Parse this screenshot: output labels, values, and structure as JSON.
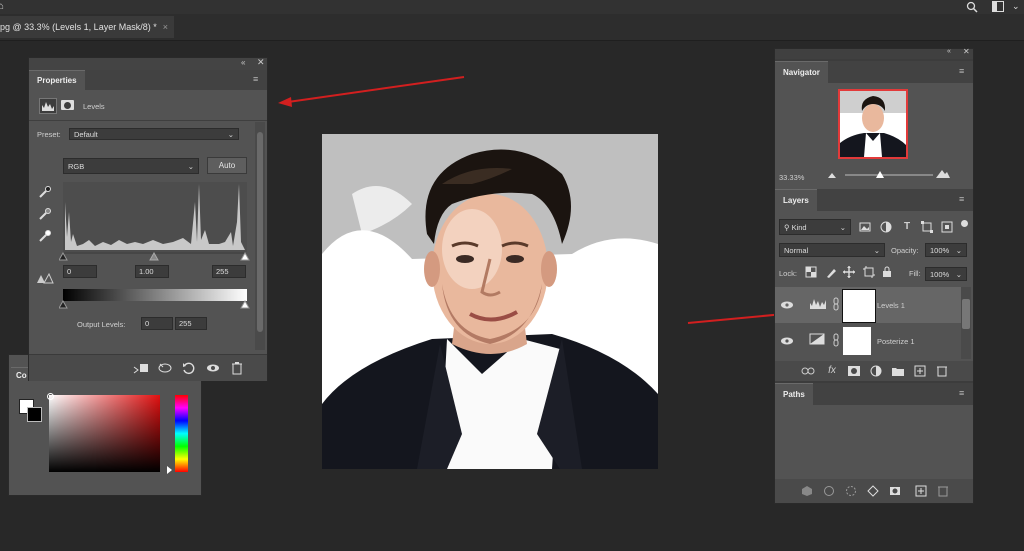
{
  "document": {
    "tab_title": "pg @ 33.3% (Levels 1, Layer Mask/8) *",
    "close_glyph": "×"
  },
  "properties": {
    "tab_label": "Properties",
    "header_label": "Levels",
    "preset_label": "Preset:",
    "preset_value": "Default",
    "channel_value": "RGB",
    "auto_label": "Auto",
    "input_black": "0",
    "input_gamma": "1.00",
    "input_white": "255",
    "output_label": "Output Levels:",
    "output_black": "0",
    "output_white": "255"
  },
  "color_panel": {
    "tab_label": "Co"
  },
  "navigator": {
    "tab_label": "Navigator",
    "zoom_value": "33.33%"
  },
  "layers": {
    "tab_label": "Layers",
    "kind_label": "Kind",
    "blend_mode": "Normal",
    "opacity_label": "Opacity:",
    "opacity_value": "100%",
    "lock_label": "Lock:",
    "fill_label": "Fill:",
    "fill_value": "100%",
    "items": [
      {
        "name": "Levels 1",
        "selected": true,
        "icon": "levels-adjustment-icon"
      },
      {
        "name": "Posterize 1",
        "selected": false,
        "icon": "posterize-adjustment-icon"
      }
    ]
  },
  "paths": {
    "tab_label": "Paths"
  },
  "colors": {
    "workspace": "#282828",
    "panel": "#535353",
    "annotation_arrow": "#d21f1f"
  }
}
